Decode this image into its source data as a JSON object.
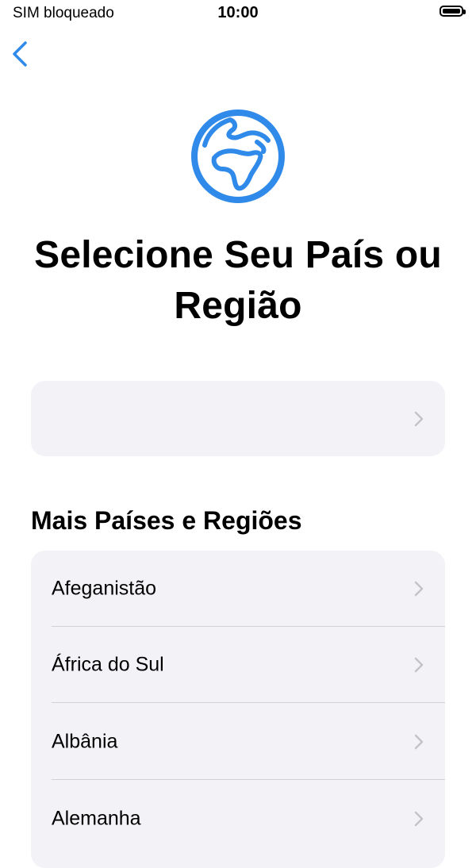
{
  "status_bar": {
    "carrier": "SIM bloqueado",
    "time": "10:00",
    "battery_icon": "battery-full-icon"
  },
  "nav": {
    "back_icon": "chevron-left-icon"
  },
  "header": {
    "icon": "globe-icon",
    "title": "Selecione Seu País ou Região"
  },
  "suggested": {
    "label": "",
    "chevron_icon": "chevron-right-icon"
  },
  "more_section": {
    "title": "Mais Países e Regiões",
    "items": [
      {
        "label": "Afeganistão"
      },
      {
        "label": "África do Sul"
      },
      {
        "label": "Albânia"
      },
      {
        "label": "Alemanha"
      }
    ]
  },
  "colors": {
    "accent": "#2f8ae9",
    "card_background": "#f2f2f7",
    "chevron": "#c4c4c8",
    "divider": "#d1d1d6"
  }
}
